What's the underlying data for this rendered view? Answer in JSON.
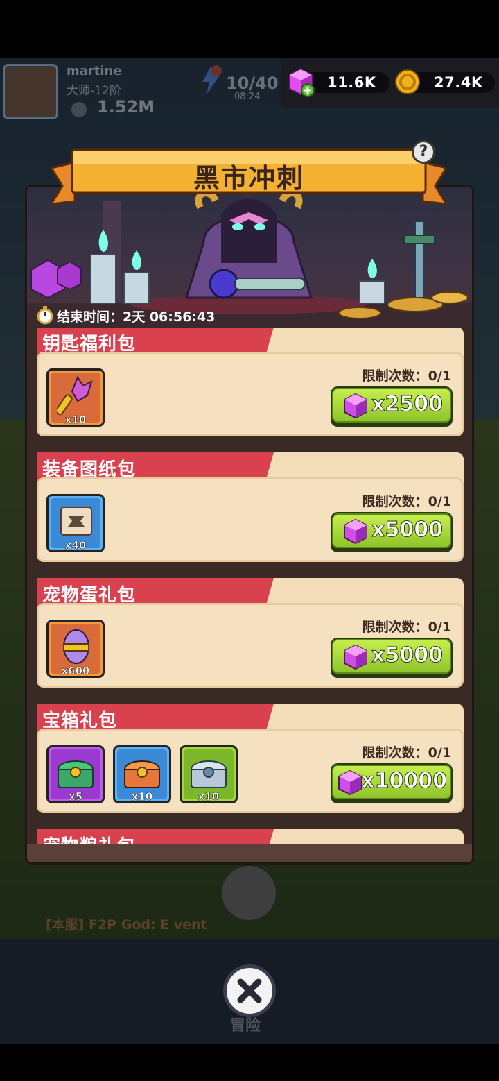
{
  "player": {
    "name": "martine",
    "rank": "大师-12阶",
    "power": "1.52M",
    "stamina": "10/40",
    "stamina_timer": "08:24"
  },
  "resources": {
    "gems": "11.6K",
    "coins": "27.4K"
  },
  "event": {
    "title": "黑市冲刺",
    "timer_label": "结束时间：2天 06:56:43"
  },
  "packs": [
    {
      "title": "钥匙福利包",
      "limit": "限制次数：0/1",
      "price": "x2500",
      "items": [
        {
          "icon": "key-icon",
          "qty": "x10"
        }
      ]
    },
    {
      "title": "装备图纸包",
      "limit": "限制次数：0/1",
      "price": "x5000",
      "items": [
        {
          "icon": "blueprint-icon",
          "qty": "x40"
        }
      ]
    },
    {
      "title": "宠物蛋礼包",
      "limit": "限制次数：0/1",
      "price": "x5000",
      "items": [
        {
          "icon": "pet-egg-icon",
          "qty": "x600"
        }
      ]
    },
    {
      "title": "宝箱礼包",
      "limit": "限制次数：0/1",
      "price": "x10000",
      "items": [
        {
          "icon": "green-chest-icon",
          "qty": "x5"
        },
        {
          "icon": "orange-chest-icon",
          "qty": "x10"
        },
        {
          "icon": "silver-chest-icon",
          "qty": "x10"
        }
      ]
    },
    {
      "title": "宠物粮礼包"
    }
  ],
  "background": {
    "chat_text": "[本服] F2P God: E vent",
    "nav_center_label": "冒险"
  },
  "colors": {
    "tag_red": "#d9414f",
    "card_bg": "#f5e1bf",
    "buy_green": "#a6d63a",
    "title_orange": "#f5b232",
    "gem_purple": "#c43ae0",
    "coin_gold": "#f2b318"
  }
}
